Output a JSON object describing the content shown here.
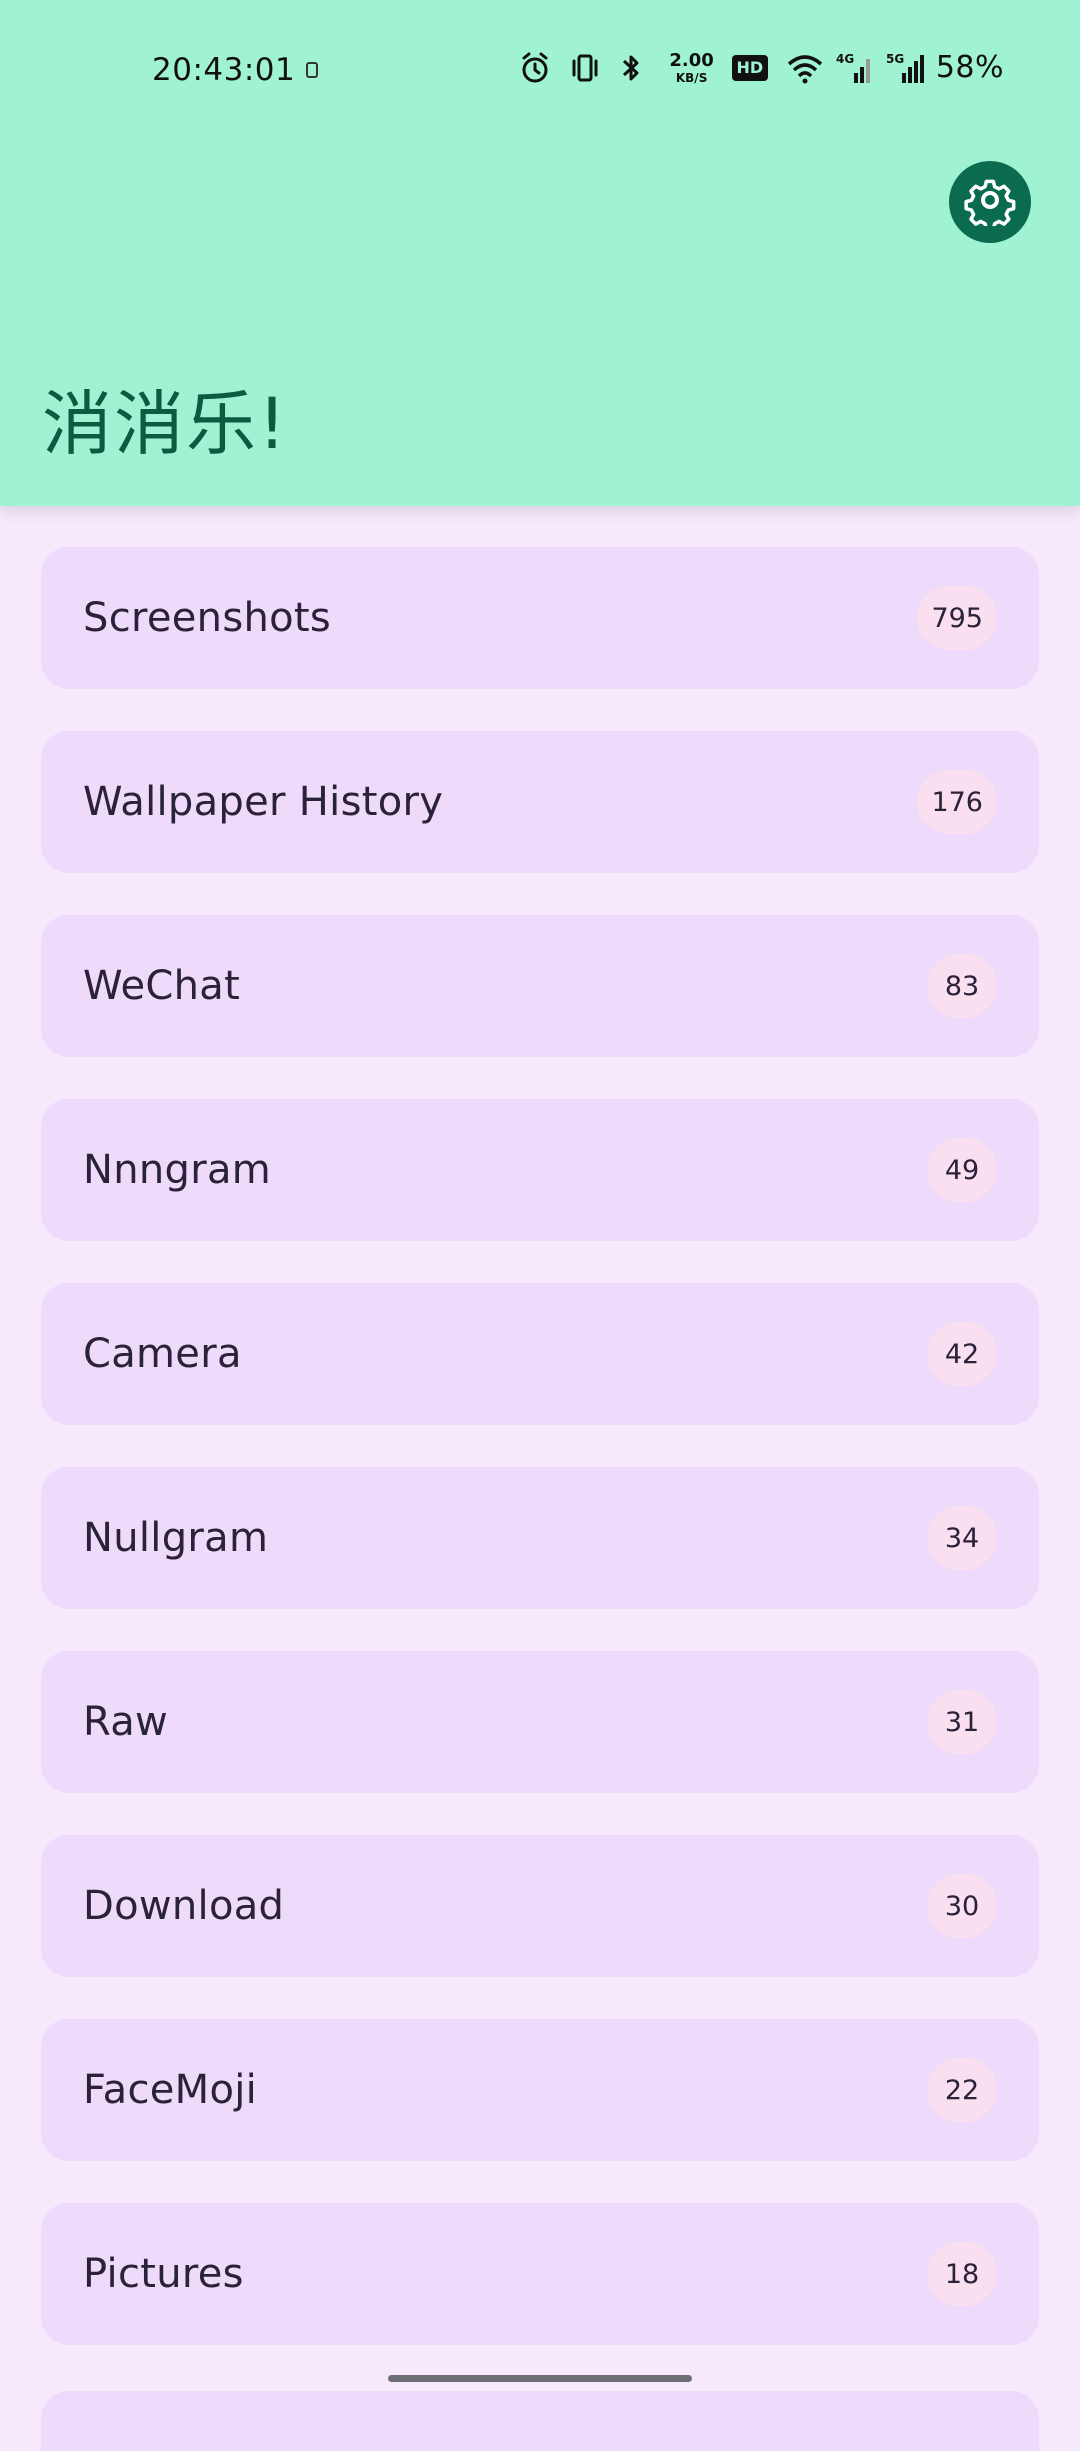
{
  "status_bar": {
    "time": "20:43:01",
    "network_speed_value": "2.00",
    "network_speed_unit": "KB/S",
    "hd_label": "HD",
    "battery": "58%",
    "icons": [
      "alarm-icon",
      "vibrate-icon",
      "bluetooth-icon",
      "hd-icon",
      "wifi-icon",
      "signal-4g-icon",
      "signal-5g-icon"
    ]
  },
  "header": {
    "title": "消消乐!",
    "settings_icon": "gear-icon"
  },
  "albums": [
    {
      "name": "Screenshots",
      "count": "795"
    },
    {
      "name": "Wallpaper History",
      "count": "176"
    },
    {
      "name": "WeChat",
      "count": "83"
    },
    {
      "name": "Nnngram",
      "count": "49"
    },
    {
      "name": "Camera",
      "count": "42"
    },
    {
      "name": "Nullgram",
      "count": "34"
    },
    {
      "name": "Raw",
      "count": "31"
    },
    {
      "name": "Download",
      "count": "30"
    },
    {
      "name": "FaceMoji",
      "count": "22"
    },
    {
      "name": "Pictures",
      "count": "18"
    }
  ],
  "colors": {
    "header_bg": "#9ff3d2",
    "title": "#0b5a42",
    "settings_button": "#0b6b4f",
    "page_bg": "#f5e9fb",
    "row_bg": "#eedafb",
    "badge_bg": "#f9dff0"
  }
}
